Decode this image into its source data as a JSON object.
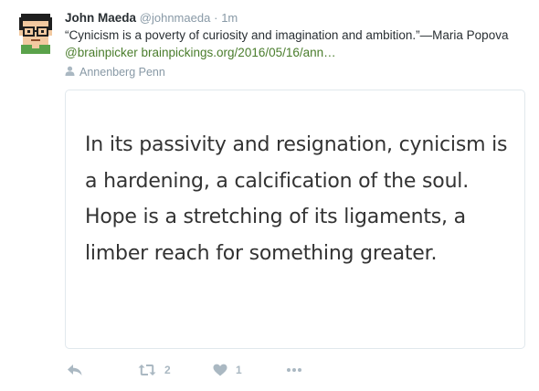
{
  "tweet": {
    "author": {
      "name": "John Maeda",
      "handle": "@johnmaeda",
      "separator": "·",
      "time": "1m"
    },
    "text_start": "“Cynicism is a poverty of curiosity and imagination and ambition.”—Maria Popova ",
    "mention": "@brainpicker",
    "link": "brainpickings.org/2016/05/16/ann…",
    "location": "Annenberg Penn",
    "card_quote": "In its passivity and resignation, cynicism is a hardening, a calcification of the soul. Hope is a stretching of its ligaments, a limber reach for something greater.",
    "actions": {
      "reply_icon": "reply-icon",
      "retweet_icon": "retweet-icon",
      "retweet_count": "2",
      "like_icon": "heart-icon",
      "like_count": "1",
      "more_icon": "more-icon"
    }
  },
  "colors": {
    "name": "#292f33",
    "muted": "#8899a6",
    "link": "#4a7d2c",
    "action": "#aab8c2",
    "card_border": "#e1e8ed"
  }
}
